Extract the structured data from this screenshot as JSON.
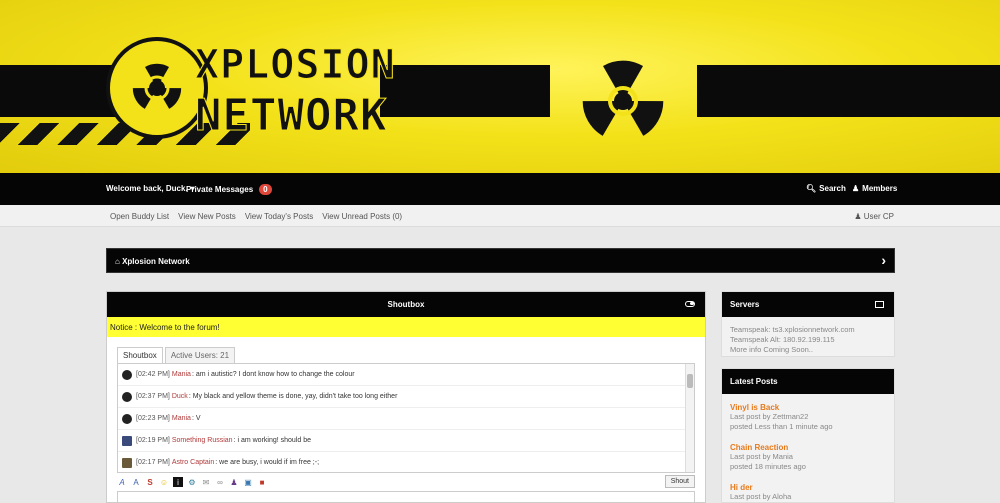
{
  "banner": {
    "logo_line1": "XPLOSION",
    "logo_line2": "NETWORK",
    "colors": {
      "yellow": "#f3e21a",
      "black": "#0a0a0a"
    }
  },
  "navbar": {
    "welcome": "Welcome back, Duck.",
    "private_messages": "Private Messages",
    "pm_count": "0",
    "search": "Search",
    "members": "Members"
  },
  "subnav": {
    "links": [
      "Open Buddy List",
      "View New Posts",
      "View Today's Posts",
      "View Unread Posts (0)"
    ],
    "user_cp": "User CP"
  },
  "breadcrumb": {
    "label": "Xplosion Network"
  },
  "shoutbox": {
    "title": "Shoutbox",
    "notice": "Notice : Welcome to the forum!",
    "tabs": [
      "Shoutbox",
      "Active Users: 21"
    ],
    "messages": [
      {
        "time": "[02:42 PM]",
        "user": "Mania",
        "text": ": am i autistic? I dont know how to change the colour"
      },
      {
        "time": "[02:37 PM]",
        "user": "Duck",
        "text": ": My black and yellow theme is done, yay, didn't take too long either"
      },
      {
        "time": "[02:23 PM]",
        "user": "Mania",
        "text": ": V"
      },
      {
        "time": "[02:19 PM]",
        "user": "Something Russian",
        "text": ": i am working! should be"
      },
      {
        "time": "[02:17 PM]",
        "user": "Astro Captain",
        "text": ": we are busy, i would if im free ;-;"
      }
    ],
    "toolbar_icons": [
      "italic-icon",
      "font-icon",
      "strike-icon",
      "smiley-icon",
      "info-icon",
      "gear-icon",
      "mail-icon",
      "link-icon",
      "user-icon",
      "image-icon",
      "exit-icon"
    ],
    "shout_button": "Shout"
  },
  "servers": {
    "title": "Servers",
    "lines": [
      "Teamspeak: ts3.xplosionnetwork.com",
      "Teamspeak Alt: 180.92.199.115",
      "More info Coming Soon.."
    ]
  },
  "latest_posts": {
    "title": "Latest Posts",
    "posts": [
      {
        "title": "Vinyl is Back",
        "last": "Last post by Zettman22",
        "when": "posted Less than 1 minute ago"
      },
      {
        "title": "Chain Reaction",
        "last": "Last post by Mania",
        "when": "posted 18 minutes ago"
      },
      {
        "title": "Hi der",
        "last": "Last post by Aloha",
        "when": ""
      }
    ]
  }
}
